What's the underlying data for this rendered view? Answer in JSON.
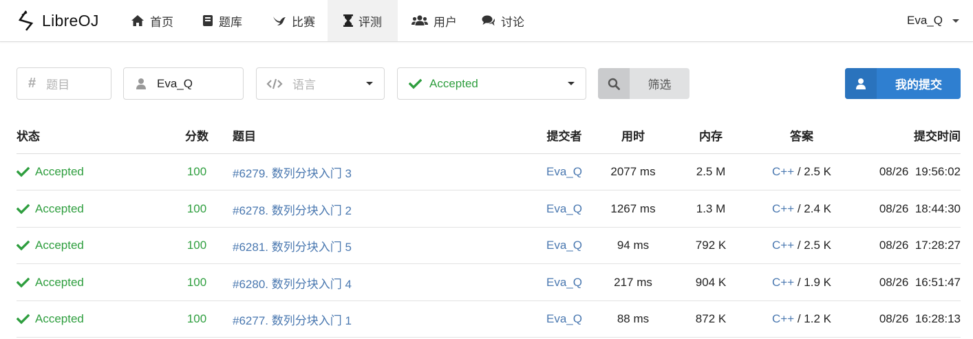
{
  "brand": {
    "name": "LibreOJ"
  },
  "nav": {
    "items": [
      {
        "label": "首页",
        "icon": "home-icon"
      },
      {
        "label": "题库",
        "icon": "book-icon"
      },
      {
        "label": "比赛",
        "icon": "bird-icon"
      },
      {
        "label": "评测",
        "icon": "hourglass-icon",
        "active": true
      },
      {
        "label": "用户",
        "icon": "users-icon"
      },
      {
        "label": "讨论",
        "icon": "comments-icon"
      }
    ],
    "user": "Eva_Q"
  },
  "filters": {
    "problem_placeholder": "题目",
    "user_value": "Eva_Q",
    "language_placeholder": "语言",
    "status_value": "Accepted",
    "filter_button": "筛选",
    "my_submissions_button": "我的提交"
  },
  "table": {
    "headers": {
      "status": "状态",
      "score": "分数",
      "problem": "题目",
      "submitter": "提交者",
      "time": "用时",
      "memory": "内存",
      "code": "答案",
      "submit_time": "提交时间"
    },
    "rows": [
      {
        "status": "Accepted",
        "score": "100",
        "problem": "#6279. 数列分块入门 3",
        "user": "Eva_Q",
        "time": "2077 ms",
        "memory": "2.5 M",
        "lang": "C++",
        "size": " / 2.5 K",
        "submit_time": "08/26  19:56:02"
      },
      {
        "status": "Accepted",
        "score": "100",
        "problem": "#6278. 数列分块入门 2",
        "user": "Eva_Q",
        "time": "1267 ms",
        "memory": "1.3 M",
        "lang": "C++",
        "size": " / 2.4 K",
        "submit_time": "08/26  18:44:30"
      },
      {
        "status": "Accepted",
        "score": "100",
        "problem": "#6281. 数列分块入门 5",
        "user": "Eva_Q",
        "time": "94 ms",
        "memory": "792 K",
        "lang": "C++",
        "size": " / 2.5 K",
        "submit_time": "08/26  17:28:27"
      },
      {
        "status": "Accepted",
        "score": "100",
        "problem": "#6280. 数列分块入门 4",
        "user": "Eva_Q",
        "time": "217 ms",
        "memory": "904 K",
        "lang": "C++",
        "size": " / 1.9 K",
        "submit_time": "08/26  16:51:47"
      },
      {
        "status": "Accepted",
        "score": "100",
        "problem": "#6277. 数列分块入门 1",
        "user": "Eva_Q",
        "time": "88 ms",
        "memory": "872 K",
        "lang": "C++",
        "size": " / 1.2 K",
        "submit_time": "08/26  16:28:13"
      }
    ]
  },
  "colors": {
    "accepted": "#2e9e3e",
    "link": "#4a78b0",
    "primary_button": "#2f7fd0"
  }
}
